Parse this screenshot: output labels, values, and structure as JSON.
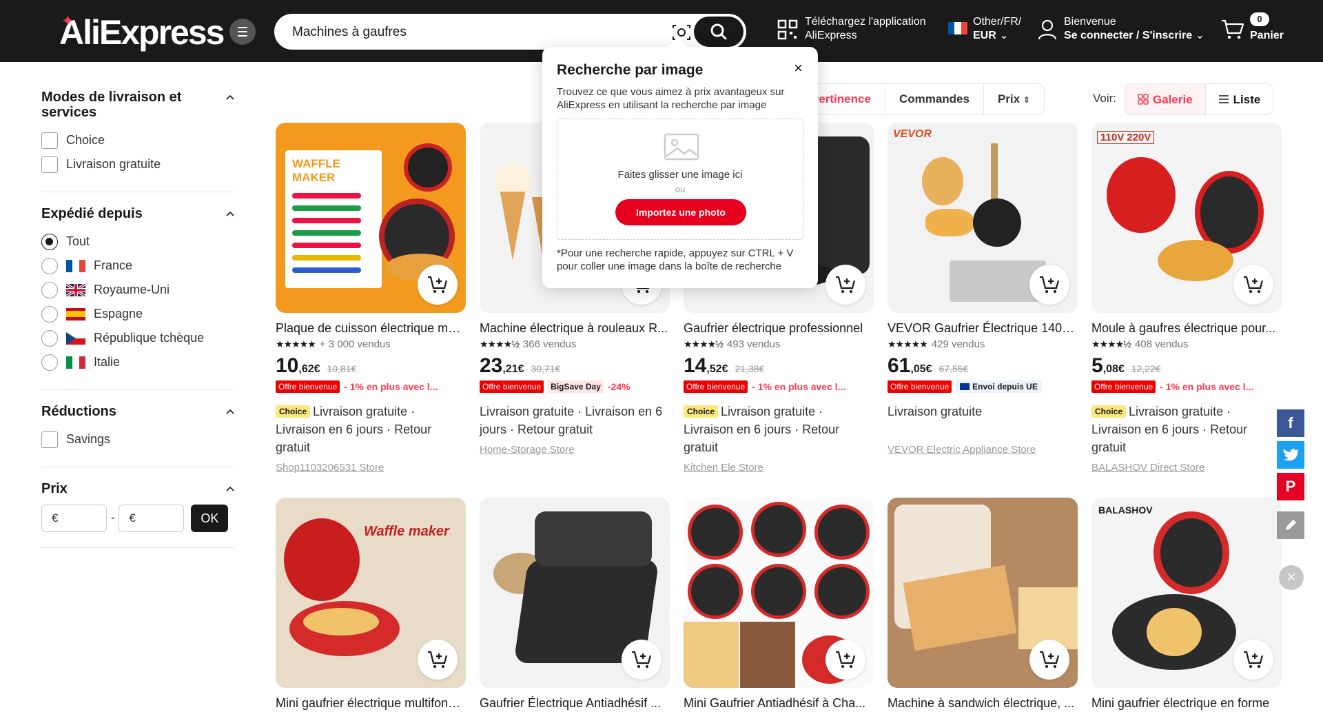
{
  "header": {
    "logo": "AliExpress",
    "search_value": "Machines à gaufres",
    "app_line1": "Téléchargez l'application",
    "app_line2": "AliExpress",
    "locale_line1": "Other/FR/",
    "locale_line2": "EUR",
    "account_line1": "Bienvenue",
    "account_line2": "Se connecter / S'inscrire",
    "cart_count": "0",
    "cart_label": "Panier"
  },
  "sidebar": {
    "delivery": {
      "title": "Modes de livraison et services",
      "options": [
        "Choice",
        "Livraison gratuite"
      ]
    },
    "shipped_from": {
      "title": "Expédié depuis",
      "options": [
        "Tout",
        "France",
        "Royaume-Uni",
        "Espagne",
        "République tchèque",
        "Italie"
      ]
    },
    "discounts": {
      "title": "Réductions",
      "options": [
        "Savings"
      ]
    },
    "price": {
      "title": "Prix",
      "min_placeholder": "€",
      "max_placeholder": "€",
      "separator": "-",
      "ok": "OK"
    }
  },
  "sort": {
    "options": [
      "Pertinence",
      "Commandes",
      "Prix"
    ],
    "view_label": "Voir:",
    "view_gallery": "Galerie",
    "view_list": "Liste"
  },
  "popover": {
    "title": "Recherche par image",
    "close": "×",
    "desc": "Trouvez ce que vous aimez à prix avantageux sur AliExpress en utilisant la recherche par image",
    "drop_text": "Faites glisser une image ici",
    "drop_or": "ou",
    "upload": "Importez une photo",
    "note": "*Pour une recherche rapide, appuyez sur CTRL + V pour coller une image dans la boîte de recherche"
  },
  "products": [
    {
      "title": "Plaque de cuisson électrique multifonction",
      "sold": "+ 3 000 vendus",
      "price_int": "10",
      "price_dec": ",62€",
      "old": "10,81€",
      "badge": "Offre bienvenue",
      "promo": "- 1% en plus avec l...",
      "choice": "Choice",
      "ship": "Livraison gratuite · Livraison en 6 jours · Retour gratuit",
      "store": "Shop1103206531 Store",
      "img_text": "WAFFLE MAKER"
    },
    {
      "title": "Machine électrique à rouleaux R...",
      "sold": "366 vendus",
      "price_int": "23",
      "price_dec": ",21€",
      "old": "30,71€",
      "badge": "Offre bienvenue",
      "promo": "-24%",
      "extra_tag": "BigSave Day",
      "choice": "",
      "ship": "Livraison gratuite · Livraison en 6 jours · Retour gratuit",
      "store": "Home-Storage Store",
      "img_text": ""
    },
    {
      "title": "Gaufrier électrique professionnel",
      "sold": "493 vendus",
      "price_int": "14",
      "price_dec": ",52€",
      "old": "21,38€",
      "badge": "Offre bienvenue",
      "promo": "- 1% en plus avec l...",
      "choice": "Choice",
      "ship": "Livraison gratuite · Livraison en 6 jours · Retour gratuit",
      "store": "Kitchen Ele Store",
      "img_text": ""
    },
    {
      "title": "VEVOR Gaufrier Électrique 1400...",
      "sold": "429 vendus",
      "price_int": "61",
      "price_dec": ",05€",
      "old": "67,55€",
      "badge": "Offre bienvenue",
      "promo": "",
      "extra_tag": "Envoi depuis UE",
      "choice": "",
      "ship": "Livraison gratuite",
      "store": "VEVOR Electric Appliance Store",
      "img_text": "VEVOR"
    },
    {
      "title": "Moule à gaufres électrique pour...",
      "sold": "408 vendus",
      "price_int": "5",
      "price_dec": ",08€",
      "old": "12,22€",
      "badge": "Offre bienvenue",
      "promo": "- 1% en plus avec l...",
      "choice": "Choice",
      "ship": "Livraison gratuite · Livraison en 6 jours · Retour gratuit",
      "store": "BALASHOV Direct Store",
      "img_text": "110V 220V"
    },
    {
      "title": "Mini gaufrier électrique multifonction",
      "img_text": "Waffle maker"
    },
    {
      "title": "Gaufrier Électrique Antiadhésif ...",
      "img_text": ""
    },
    {
      "title": "Mini Gaufrier Antiadhésif à Cha...",
      "img_text": ""
    },
    {
      "title": "Machine à sandwich électrique, ...",
      "img_text": ""
    },
    {
      "title": "Mini gaufrier électrique en forme",
      "img_text": "BALASHOV"
    }
  ],
  "colors": {
    "brand": "#fd384f",
    "header_bg": "#1a1a1a",
    "badge_red": "#e00000",
    "choice_yellow": "#fce77d"
  }
}
